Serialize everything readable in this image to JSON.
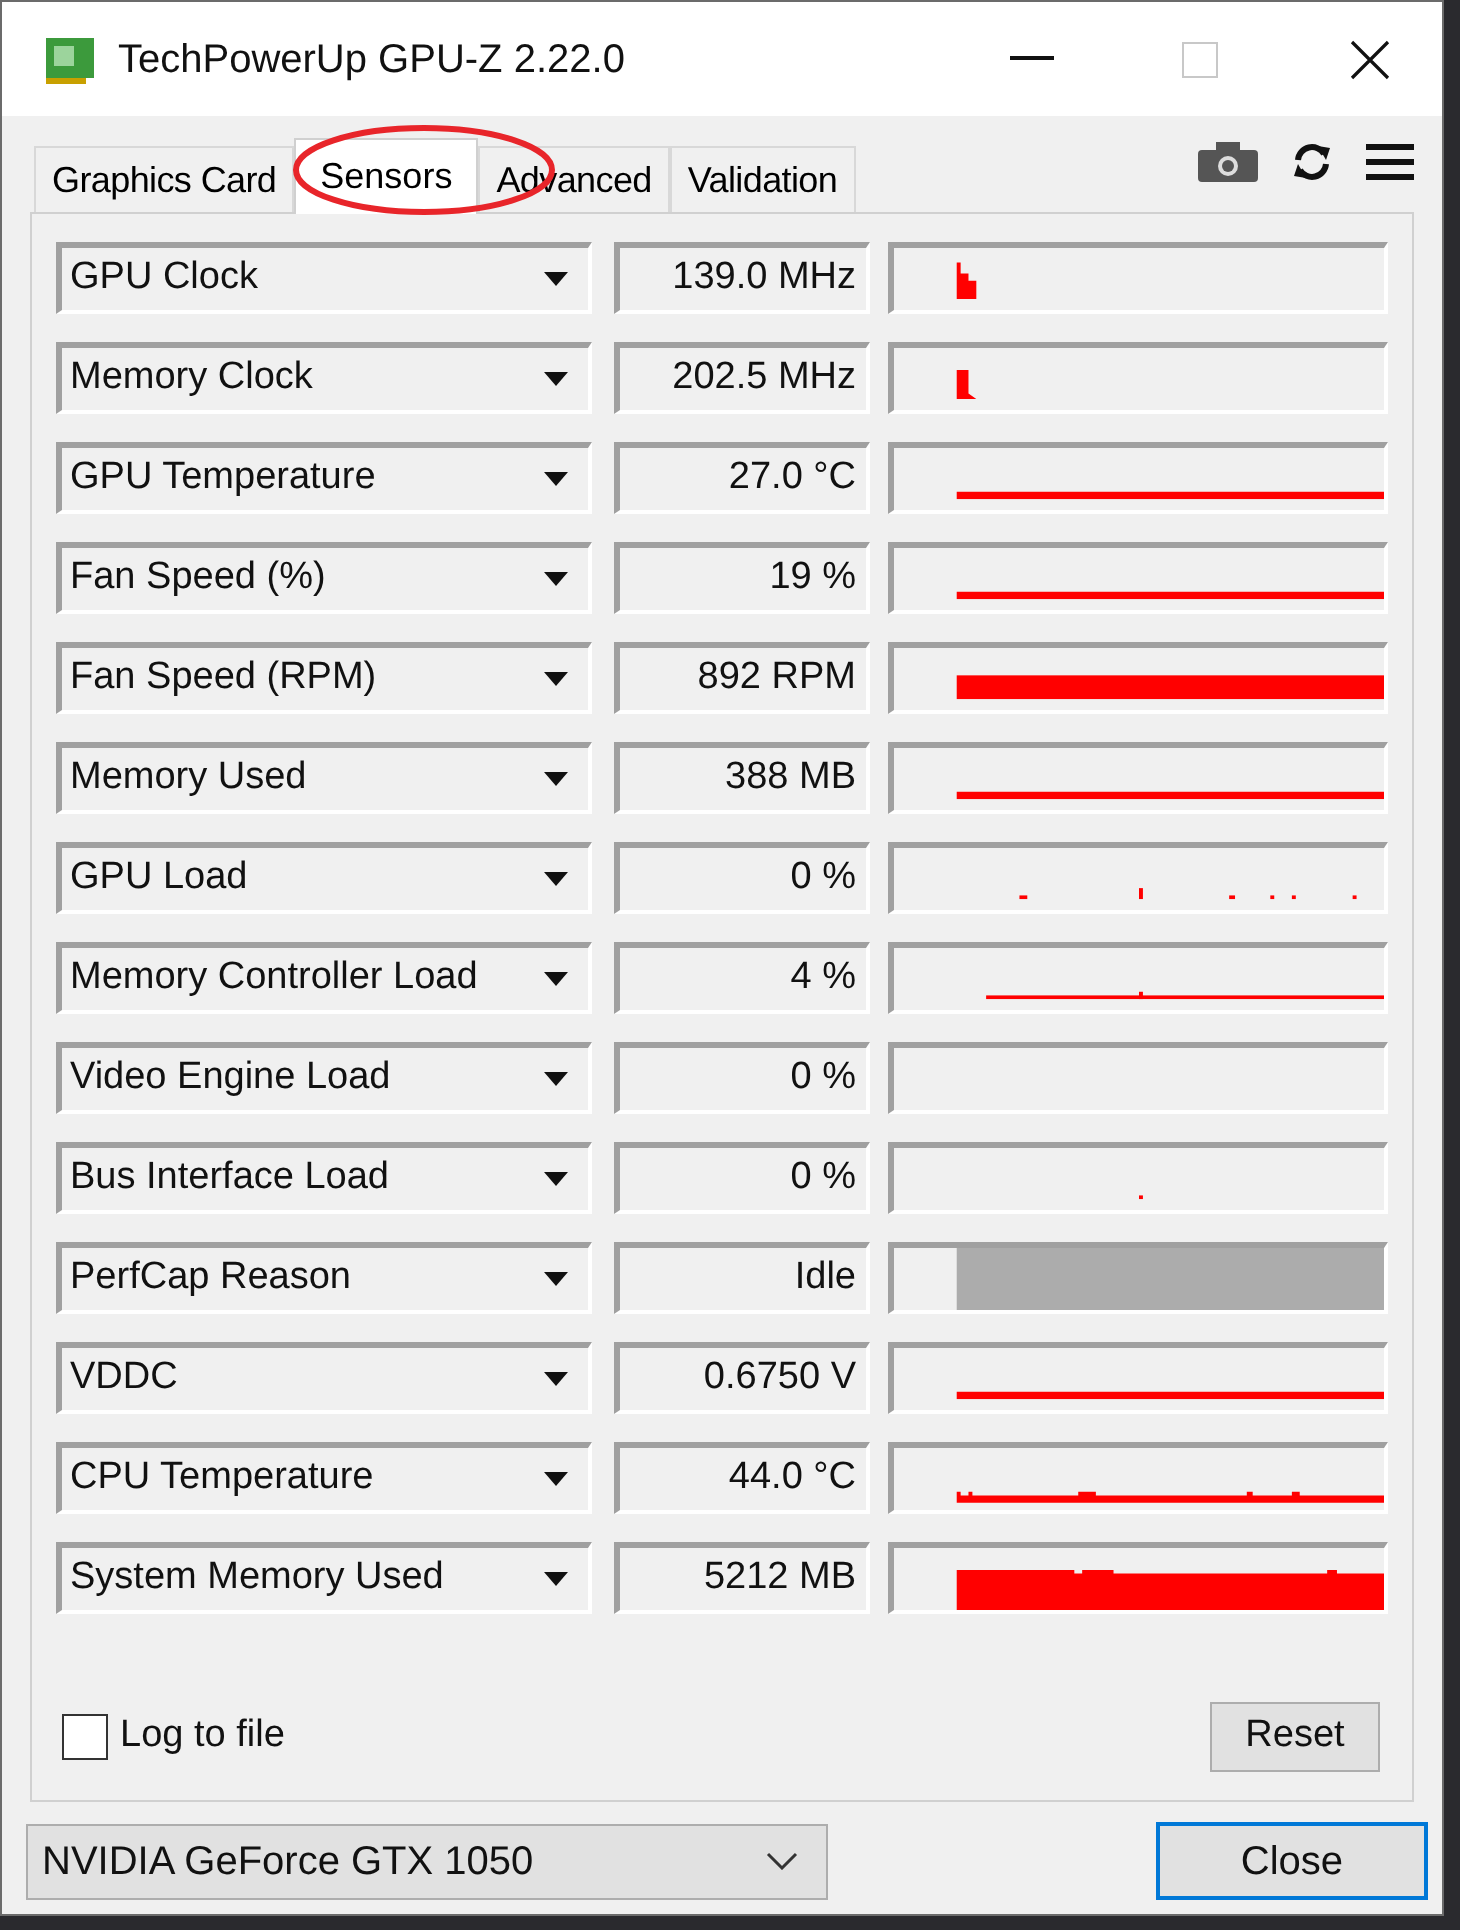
{
  "window": {
    "title": "TechPowerUp GPU-Z 2.22.0"
  },
  "tabs": [
    {
      "label": "Graphics Card",
      "selected": false
    },
    {
      "label": "Sensors",
      "selected": true
    },
    {
      "label": "Advanced",
      "selected": false
    },
    {
      "label": "Validation",
      "selected": false
    }
  ],
  "sensors": [
    {
      "name": "GPU Clock",
      "value": "139.0 MHz",
      "kind": "spike"
    },
    {
      "name": "Memory Clock",
      "value": "202.5 MHz",
      "kind": "step"
    },
    {
      "name": "GPU Temperature",
      "value": "27.0 °C",
      "kind": "line"
    },
    {
      "name": "Fan Speed (%)",
      "value": "19 %",
      "kind": "line"
    },
    {
      "name": "Fan Speed (RPM)",
      "value": "892 RPM",
      "kind": "band"
    },
    {
      "name": "Memory Used",
      "value": "388 MB",
      "kind": "line"
    },
    {
      "name": "GPU Load",
      "value": "0 %",
      "kind": "dots"
    },
    {
      "name": "Memory Controller Load",
      "value": "4 %",
      "kind": "thin"
    },
    {
      "name": "Video Engine Load",
      "value": "0 %",
      "kind": "empty"
    },
    {
      "name": "Bus Interface Load",
      "value": "0 %",
      "kind": "dot"
    },
    {
      "name": "PerfCap Reason",
      "value": "Idle",
      "kind": "gray"
    },
    {
      "name": "VDDC",
      "value": "0.6750 V",
      "kind": "line"
    },
    {
      "name": "CPU Temperature",
      "value": "44.0 °C",
      "kind": "bumpy"
    },
    {
      "name": "System Memory Used",
      "value": "5212 MB",
      "kind": "block"
    }
  ],
  "log_to_file": {
    "label": "Log to file",
    "checked": false
  },
  "reset_button": "Reset",
  "gpu_select": {
    "value": "NVIDIA GeForce GTX 1050"
  },
  "close_button": "Close"
}
